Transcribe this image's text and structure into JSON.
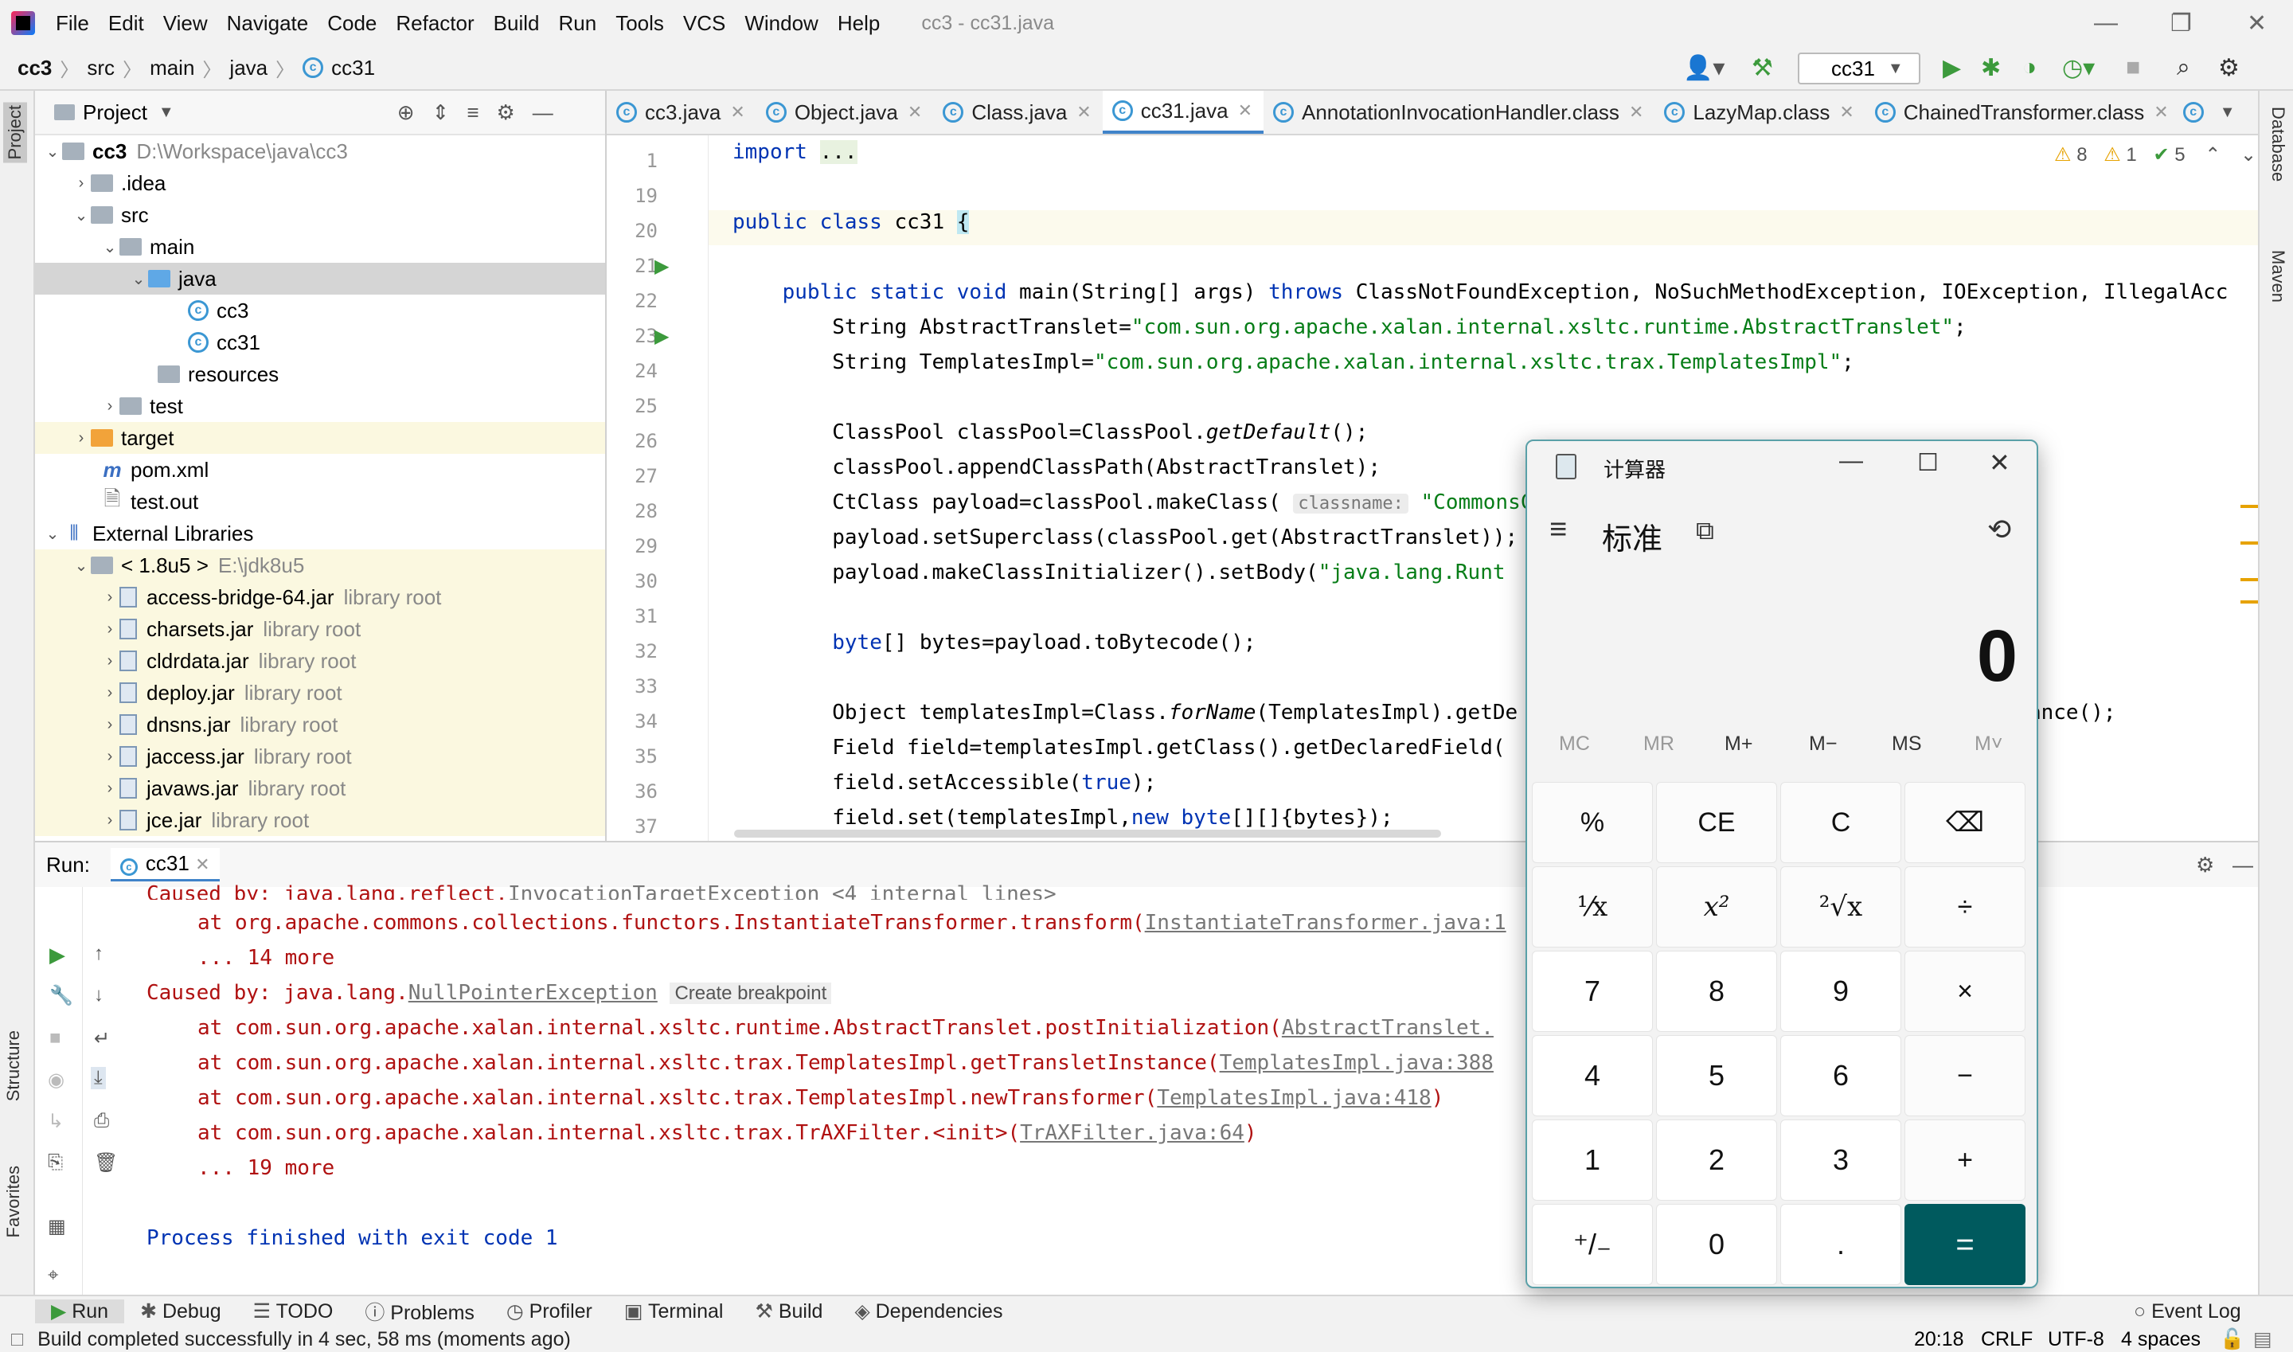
{
  "window": {
    "title": "cc3 - cc31.java",
    "menu": [
      "File",
      "Edit",
      "View",
      "Navigate",
      "Code",
      "Refactor",
      "Build",
      "Run",
      "Tools",
      "VCS",
      "Window",
      "Help"
    ]
  },
  "breadcrumb": [
    "cc3",
    "src",
    "main",
    "java",
    "cc31"
  ],
  "toolbar": {
    "run_config": "cc31"
  },
  "project_panel": {
    "title": "Project",
    "tree": [
      {
        "label": "cc3",
        "extra": "D:\\Workspace\\java\\cc3"
      },
      {
        "label": ".idea"
      },
      {
        "label": "src"
      },
      {
        "label": "main"
      },
      {
        "label": "java"
      },
      {
        "label": "cc3"
      },
      {
        "label": "cc31"
      },
      {
        "label": "resources"
      },
      {
        "label": "test"
      },
      {
        "label": "target"
      },
      {
        "label": "pom.xml"
      },
      {
        "label": "test.out"
      },
      {
        "label": "External Libraries"
      },
      {
        "label": "< 1.8u5 >",
        "extra": "E:\\jdk8u5"
      },
      {
        "label": "access-bridge-64.jar",
        "extra": "library root"
      },
      {
        "label": "charsets.jar",
        "extra": "library root"
      },
      {
        "label": "cldrdata.jar",
        "extra": "library root"
      },
      {
        "label": "deploy.jar",
        "extra": "library root"
      },
      {
        "label": "dnsns.jar",
        "extra": "library root"
      },
      {
        "label": "jaccess.jar",
        "extra": "library root"
      },
      {
        "label": "javaws.jar",
        "extra": "library root"
      },
      {
        "label": "jce.jar",
        "extra": "library root"
      }
    ]
  },
  "editor": {
    "tabs": [
      "cc3.java",
      "Object.java",
      "Class.java",
      "cc31.java",
      "AnnotationInvocationHandler.class",
      "LazyMap.class",
      "ChainedTransformer.class"
    ],
    "active_tab": "cc31.java",
    "inspections": {
      "warnings": "8",
      "weak_warnings": "1",
      "ok": "5"
    },
    "line_numbers": [
      "1",
      "19",
      "20",
      "21",
      "22",
      "23",
      "24",
      "25",
      "26",
      "27",
      "28",
      "29",
      "30",
      "31",
      "32",
      "33",
      "34",
      "35",
      "36",
      "37"
    ],
    "hint_classname": "classname:"
  },
  "run_panel": {
    "label": "Run:",
    "tab": "cc31",
    "create_breakpoint": "Create breakpoint",
    "process_finished": "Process finished with exit code 1"
  },
  "bottom_tools": [
    "Run",
    "Debug",
    "TODO",
    "Problems",
    "Profiler",
    "Terminal",
    "Build",
    "Dependencies"
  ],
  "event_log": "Event Log",
  "status": {
    "message": "Build completed successfully in 4 sec, 58 ms (moments ago)",
    "position": "20:18",
    "line_sep": "CRLF",
    "encoding": "UTF-8",
    "indent": "4 spaces"
  },
  "side_labels": {
    "left_top": "Project",
    "left_mid": "Structure",
    "left_bot": "Favorites",
    "right_top": "Database",
    "right_mid": "Maven"
  },
  "calculator": {
    "title": "计算器",
    "mode": "标准",
    "display": "0",
    "memory": [
      "MC",
      "MR",
      "M+",
      "M−",
      "MS",
      "M˅"
    ],
    "keys": [
      "%",
      "CE",
      "C",
      "⌫",
      "¹⁄x",
      "x²",
      "²√x",
      "÷",
      "7",
      "8",
      "9",
      "×",
      "4",
      "5",
      "6",
      "−",
      "1",
      "2",
      "3",
      "+",
      "⁺/₋",
      "0",
      ".",
      "="
    ]
  }
}
